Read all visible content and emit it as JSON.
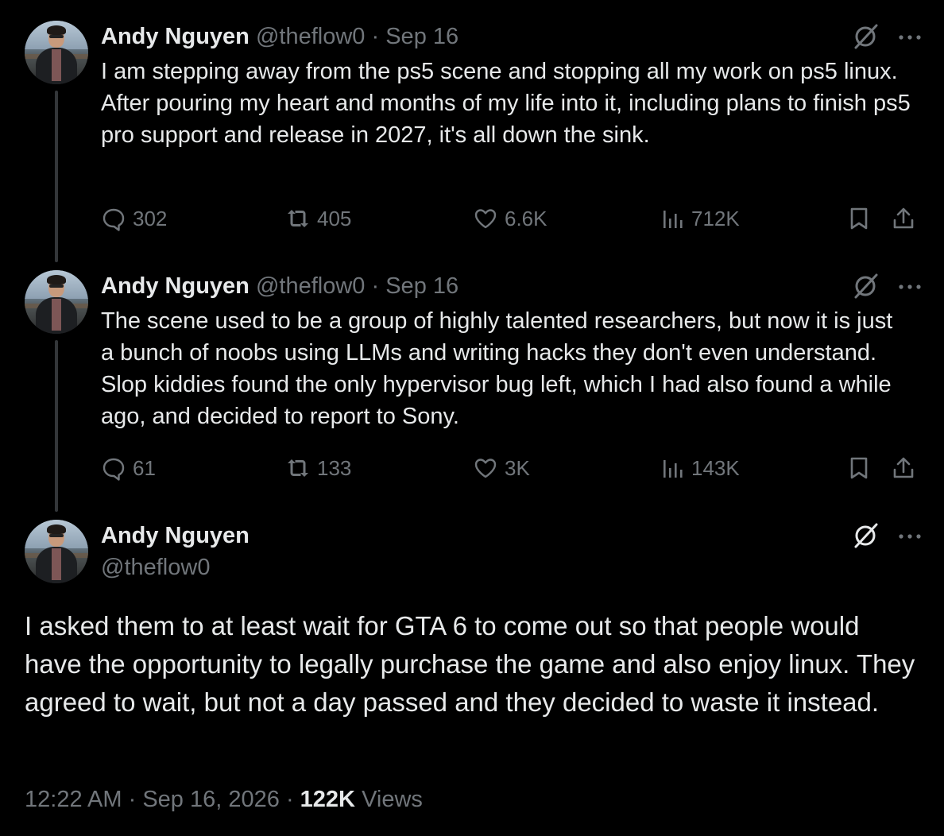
{
  "tweets": [
    {
      "name": "Andy Nguyen",
      "handle": "@theflow0",
      "separator": "·",
      "date": "Sep 16",
      "lines": [
        "I am stepping away from the ps5 scene and stopping all my work on ps5 linux.",
        "After pouring my heart and months of my life into it, including plans to finish ps5 pro support and release in 2027, it's all down the sink."
      ],
      "replies": "302",
      "reposts": "405",
      "likes": "6.6K",
      "views": "712K"
    },
    {
      "name": "Andy Nguyen",
      "handle": "@theflow0",
      "separator": "·",
      "date": "Sep 16",
      "lines": [
        "The scene used to be a group of highly talented researchers, but now it is just a bunch of noobs using LLMs and writing hacks they don't even understand. Slop kiddies found the only hypervisor bug left, which I had also found a while ago, and decided to report to Sony."
      ],
      "replies": "61",
      "reposts": "133",
      "likes": "3K",
      "views": "143K"
    }
  ],
  "main": {
    "name": "Andy Nguyen",
    "handle": "@theflow0",
    "text": "I asked them to at least wait for GTA 6 to come out so that people would have the opportunity to legally purchase the game and also enjoy linux. They agreed to wait, but not a day passed and they decided to waste it instead.",
    "time": "12:22 AM",
    "separator": "·",
    "date": "Sep 16, 2026",
    "views_count": "122K",
    "views_label": "Views"
  },
  "icons": {
    "grok": "grok-slash-icon",
    "more": "more-dots-icon",
    "reply": "reply-bubble-icon",
    "repost": "repost-arrows-icon",
    "like": "heart-icon",
    "views": "views-bars-icon",
    "bookmark": "bookmark-icon",
    "share": "share-icon"
  },
  "colors": {
    "background": "#000000",
    "text": "#e7e9ea",
    "secondary": "#71767b",
    "thread_line": "#333639"
  }
}
